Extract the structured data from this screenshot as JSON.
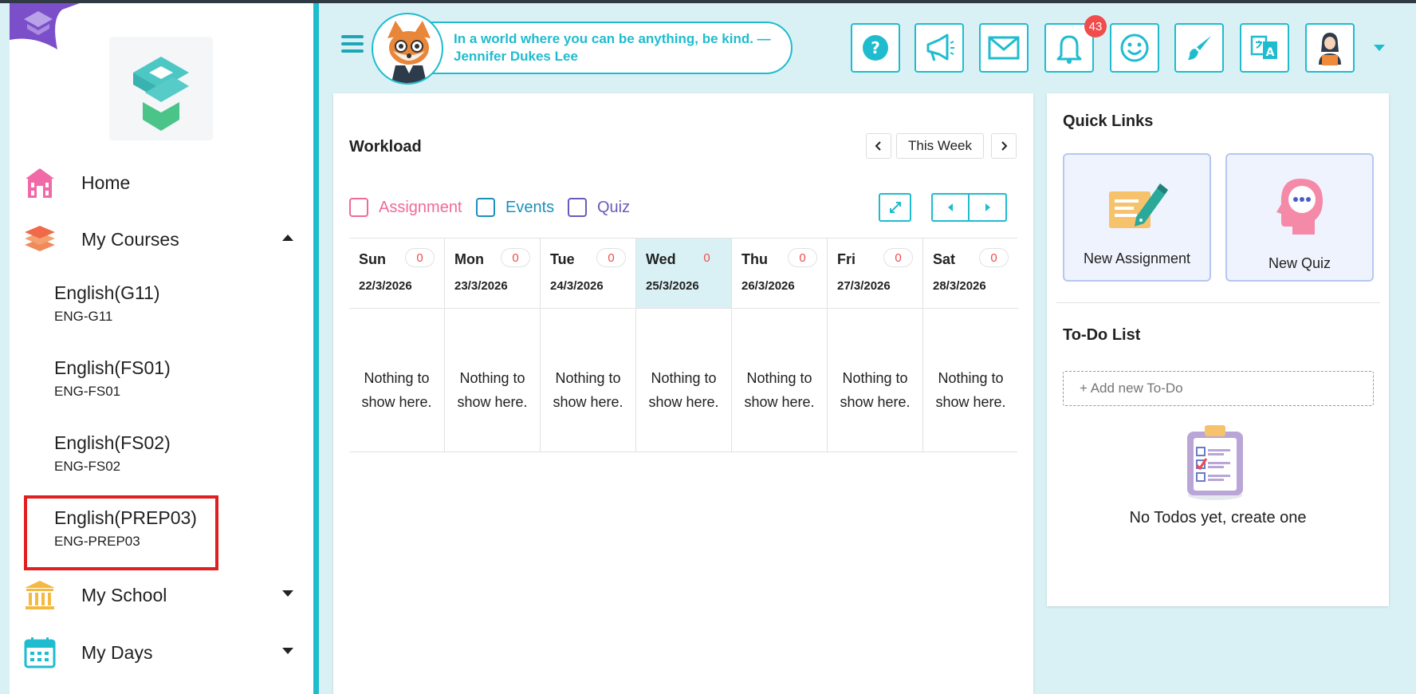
{
  "sidebar": {
    "nav": {
      "home": "Home",
      "my_courses": "My Courses",
      "my_school": "My School",
      "my_days": "My Days"
    },
    "courses": [
      {
        "name": "English(G11)",
        "code": "ENG-G11"
      },
      {
        "name": "English(FS01)",
        "code": "ENG-FS01"
      },
      {
        "name": "English(FS02)",
        "code": "ENG-FS02"
      },
      {
        "name": "English(PREP03)",
        "code": "ENG-PREP03"
      }
    ]
  },
  "header": {
    "quote": "In a world where you can be anything, be kind. — Jennifer Dukes Lee",
    "notification_count": "43",
    "buttons": [
      "help-icon",
      "megaphone-icon",
      "mail-icon",
      "bell-icon",
      "smiley-icon",
      "paintbrush-icon",
      "translate-icon",
      "profile-icon"
    ]
  },
  "workload": {
    "title": "Workload",
    "range_label": "This Week",
    "legend": [
      {
        "label": "Assignment",
        "color": "#f06a99"
      },
      {
        "label": "Events",
        "color": "#1f8fb8"
      },
      {
        "label": "Quiz",
        "color": "#6a5bb8"
      }
    ],
    "days": [
      {
        "name": "Sun",
        "count": "0",
        "date": "22/3/2026",
        "empty_line1": "Nothing to",
        "empty_line2": "show here."
      },
      {
        "name": "Mon",
        "count": "0",
        "date": "23/3/2026",
        "empty_line1": "Nothing to",
        "empty_line2": "show here."
      },
      {
        "name": "Tue",
        "count": "0",
        "date": "24/3/2026",
        "empty_line1": "Nothing to",
        "empty_line2": "show here."
      },
      {
        "name": "Wed",
        "count": "0",
        "date": "25/3/2026",
        "empty_line1": "Nothing to",
        "empty_line2": "show here."
      },
      {
        "name": "Thu",
        "count": "0",
        "date": "26/3/2026",
        "empty_line1": "Nothing to",
        "empty_line2": "show here."
      },
      {
        "name": "Fri",
        "count": "0",
        "date": "27/3/2026",
        "empty_line1": "Nothing to",
        "empty_line2": "show here."
      },
      {
        "name": "Sat",
        "count": "0",
        "date": "28/3/2026",
        "empty_line1": "Nothing to",
        "empty_line2": "show here."
      }
    ]
  },
  "quick_links": {
    "title": "Quick Links",
    "new_assignment": "New Assignment",
    "new_quiz": "New Quiz"
  },
  "todo": {
    "title": "To-Do List",
    "placeholder": "+ Add new To-Do",
    "empty": "No Todos yet, create one"
  },
  "colors": {
    "accent": "#1fbccf",
    "badge": "#f14b4b",
    "highlight": "#e02020"
  }
}
